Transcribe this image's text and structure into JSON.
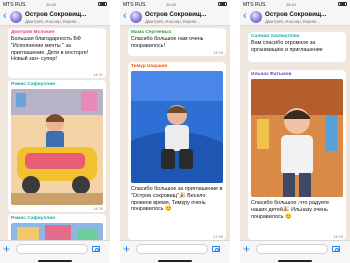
{
  "screens": [
    {
      "status": {
        "carrier": "MTS RUS",
        "time": "10:22"
      },
      "header": {
        "title": "Остров Сокровищ...",
        "subtitle": "Дмитрий, Ильнар, Карим..."
      },
      "messages": [
        {
          "sender": "Дмитрий Молокин",
          "sender_color": "#e0478a",
          "text": "Большая благодарность БФ \"Исполнение мечты \" за приглашение. Дети в восторге! Новый зал- супер!",
          "time": "14:37"
        },
        {
          "sender": "Рамис Сафиуллин",
          "sender_color": "#1fa7a3",
          "text": "",
          "time": "14:39"
        },
        {
          "sender": "Рамис Сафиуллин",
          "sender_color": "#1fa7a3",
          "text": "",
          "time": ""
        }
      ]
    },
    {
      "status": {
        "carrier": "MTS RUS",
        "time": "10:22"
      },
      "header": {
        "title": "Остров Сокровищ...",
        "subtitle": "Дмитрий, Ильнар, Карим..."
      },
      "messages": [
        {
          "sender": "Мама Сергеевых",
          "sender_color": "#2f9e44",
          "text": "Спасибо большое нам очень понравилось!",
          "time": "14:26"
        },
        {
          "sender": "Тимур Шаршин",
          "sender_color": "#e8590c",
          "text": "Спасибо большое за приглашение в \"Остров сокровищ\"🎉 Весело провели время, Тимуру очень понравилось 😊",
          "time": "17:48"
        }
      ]
    },
    {
      "status": {
        "carrier": "MTS RUS",
        "time": "10:21"
      },
      "header": {
        "title": "Остров Сокровищ...",
        "subtitle": "Дмитрий, Ильнар, Карим..."
      },
      "messages": [
        {
          "sender": "Салман Хасбиуллин",
          "sender_color": "#1fa7a3",
          "text": "Вам спасибо огромное за организацию и приглашение",
          "time": ""
        },
        {
          "sender": "Ильназ Фатыхов",
          "sender_color": "#6f42c1",
          "text": "Спасибо большое ,что радуете наших детей🎉 Ильназу очень понравилось 😊",
          "time": "14:33"
        }
      ]
    }
  ],
  "colors": {
    "accent": "#1a84ff",
    "chat_background": "#efe7dd",
    "bubble": "#ffffff",
    "bar": "#f6f6f6"
  }
}
